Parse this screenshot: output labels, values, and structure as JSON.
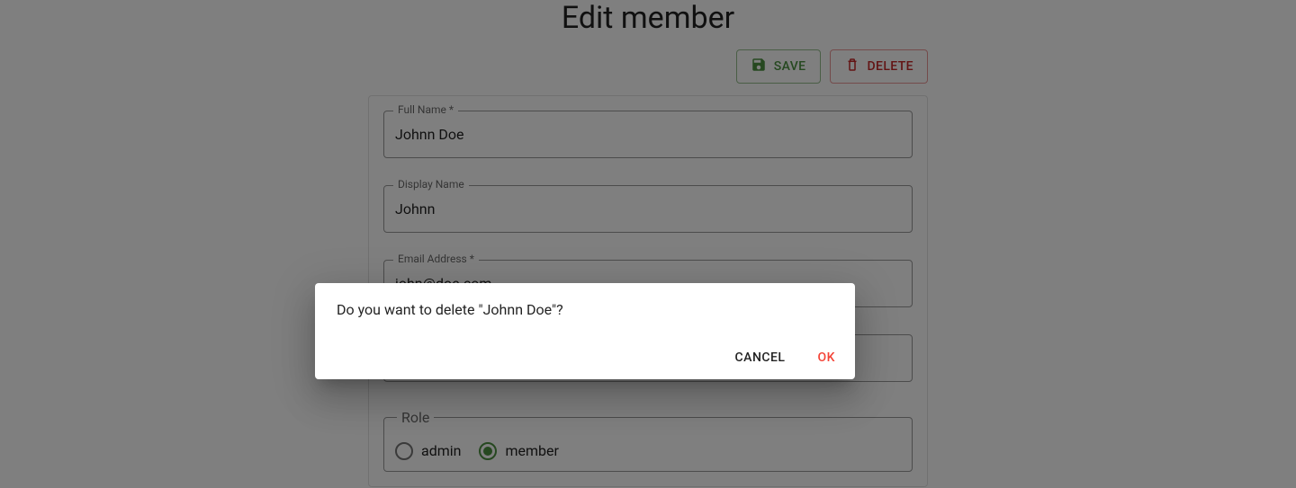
{
  "page": {
    "title": "Edit member"
  },
  "actions": {
    "save_label": "SAVE",
    "delete_label": "DELETE"
  },
  "form": {
    "full_name": {
      "label": "Full Name *",
      "value": "Johnn Doe"
    },
    "display_name": {
      "label": "Display Name",
      "value": "Johnn"
    },
    "email": {
      "label": "Email Address *",
      "value": "john@doe.com"
    },
    "phone": {
      "label": "",
      "value": ""
    },
    "role": {
      "legend": "Role",
      "options": [
        {
          "label": "admin",
          "checked": false
        },
        {
          "label": "member",
          "checked": true
        }
      ]
    }
  },
  "dialog": {
    "message": "Do you want to delete \"Johnn Doe\"?",
    "cancel_label": "CANCEL",
    "ok_label": "OK"
  }
}
